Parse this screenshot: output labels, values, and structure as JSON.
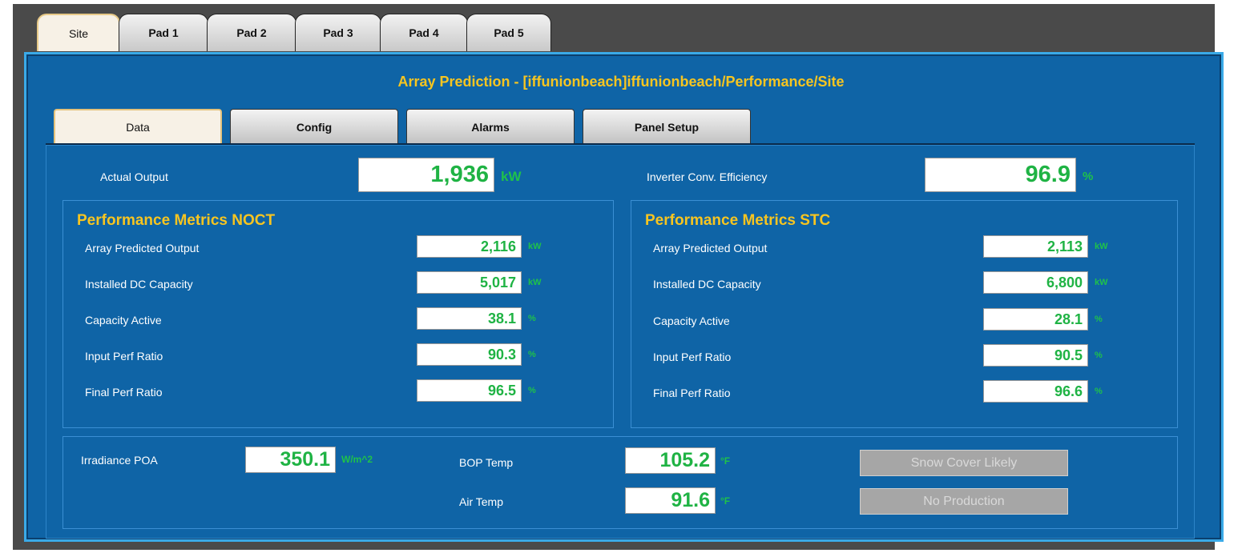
{
  "top_tabs": [
    "Site",
    "Pad 1",
    "Pad 2",
    "Pad 3",
    "Pad 4",
    "Pad 5"
  ],
  "title": "Array Prediction - [iffunionbeach]iffunionbeach/Performance/Site",
  "sub_tabs": [
    "Data",
    "Config",
    "Alarms",
    "Panel Setup"
  ],
  "actual_output": {
    "label": "Actual Output",
    "value": "1,936",
    "unit": "kW"
  },
  "inverter_efficiency": {
    "label": "Inverter Conv. Efficiency",
    "value": "96.9",
    "unit": "%"
  },
  "noct": {
    "title": "Performance Metrics NOCT",
    "rows": [
      {
        "label": "Array Predicted Output",
        "value": "2,116",
        "unit": "kW"
      },
      {
        "label": "Installed DC Capacity",
        "value": "5,017",
        "unit": "kW"
      },
      {
        "label": "Capacity Active",
        "value": "38.1",
        "unit": "%"
      },
      {
        "label": "Input Perf Ratio",
        "value": "90.3",
        "unit": "%"
      },
      {
        "label": "Final Perf Ratio",
        "value": "96.5",
        "unit": "%"
      }
    ]
  },
  "stc": {
    "title": "Performance Metrics STC",
    "rows": [
      {
        "label": "Array Predicted Output",
        "value": "2,113",
        "unit": "kW"
      },
      {
        "label": "Installed DC Capacity",
        "value": "6,800",
        "unit": "kW"
      },
      {
        "label": "Capacity Active",
        "value": "28.1",
        "unit": "%"
      },
      {
        "label": "Input Perf Ratio",
        "value": "90.5",
        "unit": "%"
      },
      {
        "label": "Final Perf Ratio",
        "value": "96.6",
        "unit": "%"
      }
    ]
  },
  "irradiance": {
    "label": "Irradiance POA",
    "value": "350.1",
    "unit": "W/m^2"
  },
  "bop_temp": {
    "label": "BOP Temp",
    "value": "105.2",
    "unit": "°F"
  },
  "air_temp": {
    "label": "Air Temp",
    "value": "91.6",
    "unit": "°F"
  },
  "status": {
    "snow": "Snow Cover Likely",
    "no_production": "No Production"
  },
  "colors": {
    "panel_bg": "#0f64a6",
    "accent_yellow": "#f7c520",
    "value_green": "#1fb344"
  }
}
